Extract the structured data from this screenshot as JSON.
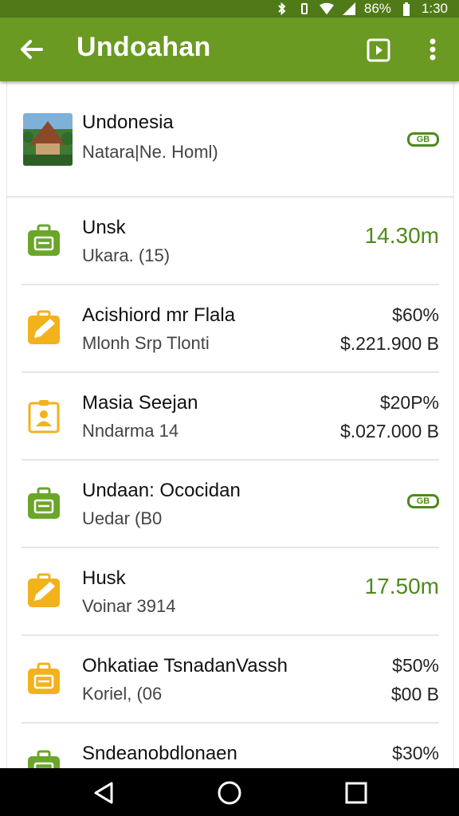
{
  "status_bar": {
    "battery": "86%",
    "time": "1:30"
  },
  "app_bar": {
    "title": "Undoahan",
    "back_icon": "arrow-left-icon",
    "action_icon": "play-square-icon",
    "more_icon": "more-vert-icon"
  },
  "header": {
    "title": "Undonesia",
    "subtitle": "Natara|Ne. Homl)",
    "chip": "GB"
  },
  "items": [
    {
      "icon": "briefcase-icon",
      "icon_color": "#6aa62a",
      "title": "Unsk",
      "subtitle": "Ukara. (15)",
      "value": "14.30m"
    },
    {
      "icon": "pencil-icon",
      "icon_color": "#f2b21c",
      "title": "Acishiord mr Flala",
      "subtitle": "Mlonh Srp Tlonti",
      "value_top": "$60%",
      "value_bottom": "$.221.900 B"
    },
    {
      "icon": "id-badge-icon",
      "icon_color": "#f2b21c",
      "title": "Masia Seejan",
      "subtitle": "Nndarma 14",
      "value_top": "$20P%",
      "value_bottom": "$.027.000 B"
    },
    {
      "icon": "briefcase-icon",
      "icon_color": "#6aa62a",
      "title": "Undaan: Ococidan",
      "subtitle": "Uedar (B0",
      "chip": "GB"
    },
    {
      "icon": "pencil-icon",
      "icon_color": "#f2b21c",
      "title": "Husk",
      "subtitle": "Voinar 3914",
      "value": "17.50m"
    },
    {
      "icon": "briefcase-icon",
      "icon_color": "#f2b21c",
      "title": "Ohkatiae TsnadanVassh",
      "subtitle": "Koriel, (06",
      "value_top": "$50%",
      "value_bottom": "$00 B"
    },
    {
      "icon": "briefcase-icon",
      "icon_color": "#6aa62a",
      "title": "Sndeanobdlonaen",
      "subtitle": "",
      "value_top": "$30%",
      "value_bottom": ""
    }
  ],
  "nav_bar": {
    "back": "nav-back-icon",
    "home": "nav-home-icon",
    "recents": "nav-recents-icon"
  }
}
